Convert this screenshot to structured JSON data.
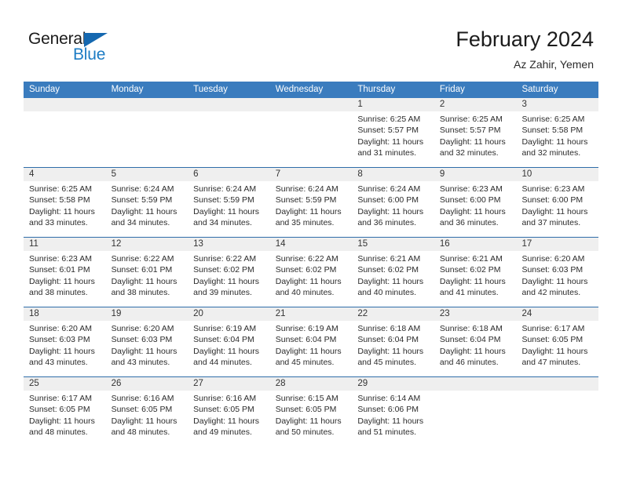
{
  "brand": {
    "name_part1": "General",
    "name_part2": "Blue",
    "triangle_color": "#1568b0",
    "blue_color": "#1d7cc4"
  },
  "header": {
    "title": "February 2024",
    "subtitle": "Az Zahir, Yemen"
  },
  "theme": {
    "header_bar_color": "#3a7cbe",
    "week_divider_color": "#2f6da9",
    "daynum_band_color": "#efefef"
  },
  "weekdays": [
    "Sunday",
    "Monday",
    "Tuesday",
    "Wednesday",
    "Thursday",
    "Friday",
    "Saturday"
  ],
  "weeks": [
    [
      {
        "day": "",
        "sunrise": "",
        "sunset": "",
        "daylight1": "",
        "daylight2": "",
        "empty": true
      },
      {
        "day": "",
        "sunrise": "",
        "sunset": "",
        "daylight1": "",
        "daylight2": "",
        "empty": true
      },
      {
        "day": "",
        "sunrise": "",
        "sunset": "",
        "daylight1": "",
        "daylight2": "",
        "empty": true
      },
      {
        "day": "",
        "sunrise": "",
        "sunset": "",
        "daylight1": "",
        "daylight2": "",
        "empty": true
      },
      {
        "day": "1",
        "sunrise": "Sunrise: 6:25 AM",
        "sunset": "Sunset: 5:57 PM",
        "daylight1": "Daylight: 11 hours",
        "daylight2": "and 31 minutes.",
        "empty": false
      },
      {
        "day": "2",
        "sunrise": "Sunrise: 6:25 AM",
        "sunset": "Sunset: 5:57 PM",
        "daylight1": "Daylight: 11 hours",
        "daylight2": "and 32 minutes.",
        "empty": false
      },
      {
        "day": "3",
        "sunrise": "Sunrise: 6:25 AM",
        "sunset": "Sunset: 5:58 PM",
        "daylight1": "Daylight: 11 hours",
        "daylight2": "and 32 minutes.",
        "empty": false
      }
    ],
    [
      {
        "day": "4",
        "sunrise": "Sunrise: 6:25 AM",
        "sunset": "Sunset: 5:58 PM",
        "daylight1": "Daylight: 11 hours",
        "daylight2": "and 33 minutes.",
        "empty": false
      },
      {
        "day": "5",
        "sunrise": "Sunrise: 6:24 AM",
        "sunset": "Sunset: 5:59 PM",
        "daylight1": "Daylight: 11 hours",
        "daylight2": "and 34 minutes.",
        "empty": false
      },
      {
        "day": "6",
        "sunrise": "Sunrise: 6:24 AM",
        "sunset": "Sunset: 5:59 PM",
        "daylight1": "Daylight: 11 hours",
        "daylight2": "and 34 minutes.",
        "empty": false
      },
      {
        "day": "7",
        "sunrise": "Sunrise: 6:24 AM",
        "sunset": "Sunset: 5:59 PM",
        "daylight1": "Daylight: 11 hours",
        "daylight2": "and 35 minutes.",
        "empty": false
      },
      {
        "day": "8",
        "sunrise": "Sunrise: 6:24 AM",
        "sunset": "Sunset: 6:00 PM",
        "daylight1": "Daylight: 11 hours",
        "daylight2": "and 36 minutes.",
        "empty": false
      },
      {
        "day": "9",
        "sunrise": "Sunrise: 6:23 AM",
        "sunset": "Sunset: 6:00 PM",
        "daylight1": "Daylight: 11 hours",
        "daylight2": "and 36 minutes.",
        "empty": false
      },
      {
        "day": "10",
        "sunrise": "Sunrise: 6:23 AM",
        "sunset": "Sunset: 6:00 PM",
        "daylight1": "Daylight: 11 hours",
        "daylight2": "and 37 minutes.",
        "empty": false
      }
    ],
    [
      {
        "day": "11",
        "sunrise": "Sunrise: 6:23 AM",
        "sunset": "Sunset: 6:01 PM",
        "daylight1": "Daylight: 11 hours",
        "daylight2": "and 38 minutes.",
        "empty": false
      },
      {
        "day": "12",
        "sunrise": "Sunrise: 6:22 AM",
        "sunset": "Sunset: 6:01 PM",
        "daylight1": "Daylight: 11 hours",
        "daylight2": "and 38 minutes.",
        "empty": false
      },
      {
        "day": "13",
        "sunrise": "Sunrise: 6:22 AM",
        "sunset": "Sunset: 6:02 PM",
        "daylight1": "Daylight: 11 hours",
        "daylight2": "and 39 minutes.",
        "empty": false
      },
      {
        "day": "14",
        "sunrise": "Sunrise: 6:22 AM",
        "sunset": "Sunset: 6:02 PM",
        "daylight1": "Daylight: 11 hours",
        "daylight2": "and 40 minutes.",
        "empty": false
      },
      {
        "day": "15",
        "sunrise": "Sunrise: 6:21 AM",
        "sunset": "Sunset: 6:02 PM",
        "daylight1": "Daylight: 11 hours",
        "daylight2": "and 40 minutes.",
        "empty": false
      },
      {
        "day": "16",
        "sunrise": "Sunrise: 6:21 AM",
        "sunset": "Sunset: 6:02 PM",
        "daylight1": "Daylight: 11 hours",
        "daylight2": "and 41 minutes.",
        "empty": false
      },
      {
        "day": "17",
        "sunrise": "Sunrise: 6:20 AM",
        "sunset": "Sunset: 6:03 PM",
        "daylight1": "Daylight: 11 hours",
        "daylight2": "and 42 minutes.",
        "empty": false
      }
    ],
    [
      {
        "day": "18",
        "sunrise": "Sunrise: 6:20 AM",
        "sunset": "Sunset: 6:03 PM",
        "daylight1": "Daylight: 11 hours",
        "daylight2": "and 43 minutes.",
        "empty": false
      },
      {
        "day": "19",
        "sunrise": "Sunrise: 6:20 AM",
        "sunset": "Sunset: 6:03 PM",
        "daylight1": "Daylight: 11 hours",
        "daylight2": "and 43 minutes.",
        "empty": false
      },
      {
        "day": "20",
        "sunrise": "Sunrise: 6:19 AM",
        "sunset": "Sunset: 6:04 PM",
        "daylight1": "Daylight: 11 hours",
        "daylight2": "and 44 minutes.",
        "empty": false
      },
      {
        "day": "21",
        "sunrise": "Sunrise: 6:19 AM",
        "sunset": "Sunset: 6:04 PM",
        "daylight1": "Daylight: 11 hours",
        "daylight2": "and 45 minutes.",
        "empty": false
      },
      {
        "day": "22",
        "sunrise": "Sunrise: 6:18 AM",
        "sunset": "Sunset: 6:04 PM",
        "daylight1": "Daylight: 11 hours",
        "daylight2": "and 45 minutes.",
        "empty": false
      },
      {
        "day": "23",
        "sunrise": "Sunrise: 6:18 AM",
        "sunset": "Sunset: 6:04 PM",
        "daylight1": "Daylight: 11 hours",
        "daylight2": "and 46 minutes.",
        "empty": false
      },
      {
        "day": "24",
        "sunrise": "Sunrise: 6:17 AM",
        "sunset": "Sunset: 6:05 PM",
        "daylight1": "Daylight: 11 hours",
        "daylight2": "and 47 minutes.",
        "empty": false
      }
    ],
    [
      {
        "day": "25",
        "sunrise": "Sunrise: 6:17 AM",
        "sunset": "Sunset: 6:05 PM",
        "daylight1": "Daylight: 11 hours",
        "daylight2": "and 48 minutes.",
        "empty": false
      },
      {
        "day": "26",
        "sunrise": "Sunrise: 6:16 AM",
        "sunset": "Sunset: 6:05 PM",
        "daylight1": "Daylight: 11 hours",
        "daylight2": "and 48 minutes.",
        "empty": false
      },
      {
        "day": "27",
        "sunrise": "Sunrise: 6:16 AM",
        "sunset": "Sunset: 6:05 PM",
        "daylight1": "Daylight: 11 hours",
        "daylight2": "and 49 minutes.",
        "empty": false
      },
      {
        "day": "28",
        "sunrise": "Sunrise: 6:15 AM",
        "sunset": "Sunset: 6:05 PM",
        "daylight1": "Daylight: 11 hours",
        "daylight2": "and 50 minutes.",
        "empty": false
      },
      {
        "day": "29",
        "sunrise": "Sunrise: 6:14 AM",
        "sunset": "Sunset: 6:06 PM",
        "daylight1": "Daylight: 11 hours",
        "daylight2": "and 51 minutes.",
        "empty": false
      },
      {
        "day": "",
        "sunrise": "",
        "sunset": "",
        "daylight1": "",
        "daylight2": "",
        "empty": true
      },
      {
        "day": "",
        "sunrise": "",
        "sunset": "",
        "daylight1": "",
        "daylight2": "",
        "empty": true
      }
    ]
  ]
}
